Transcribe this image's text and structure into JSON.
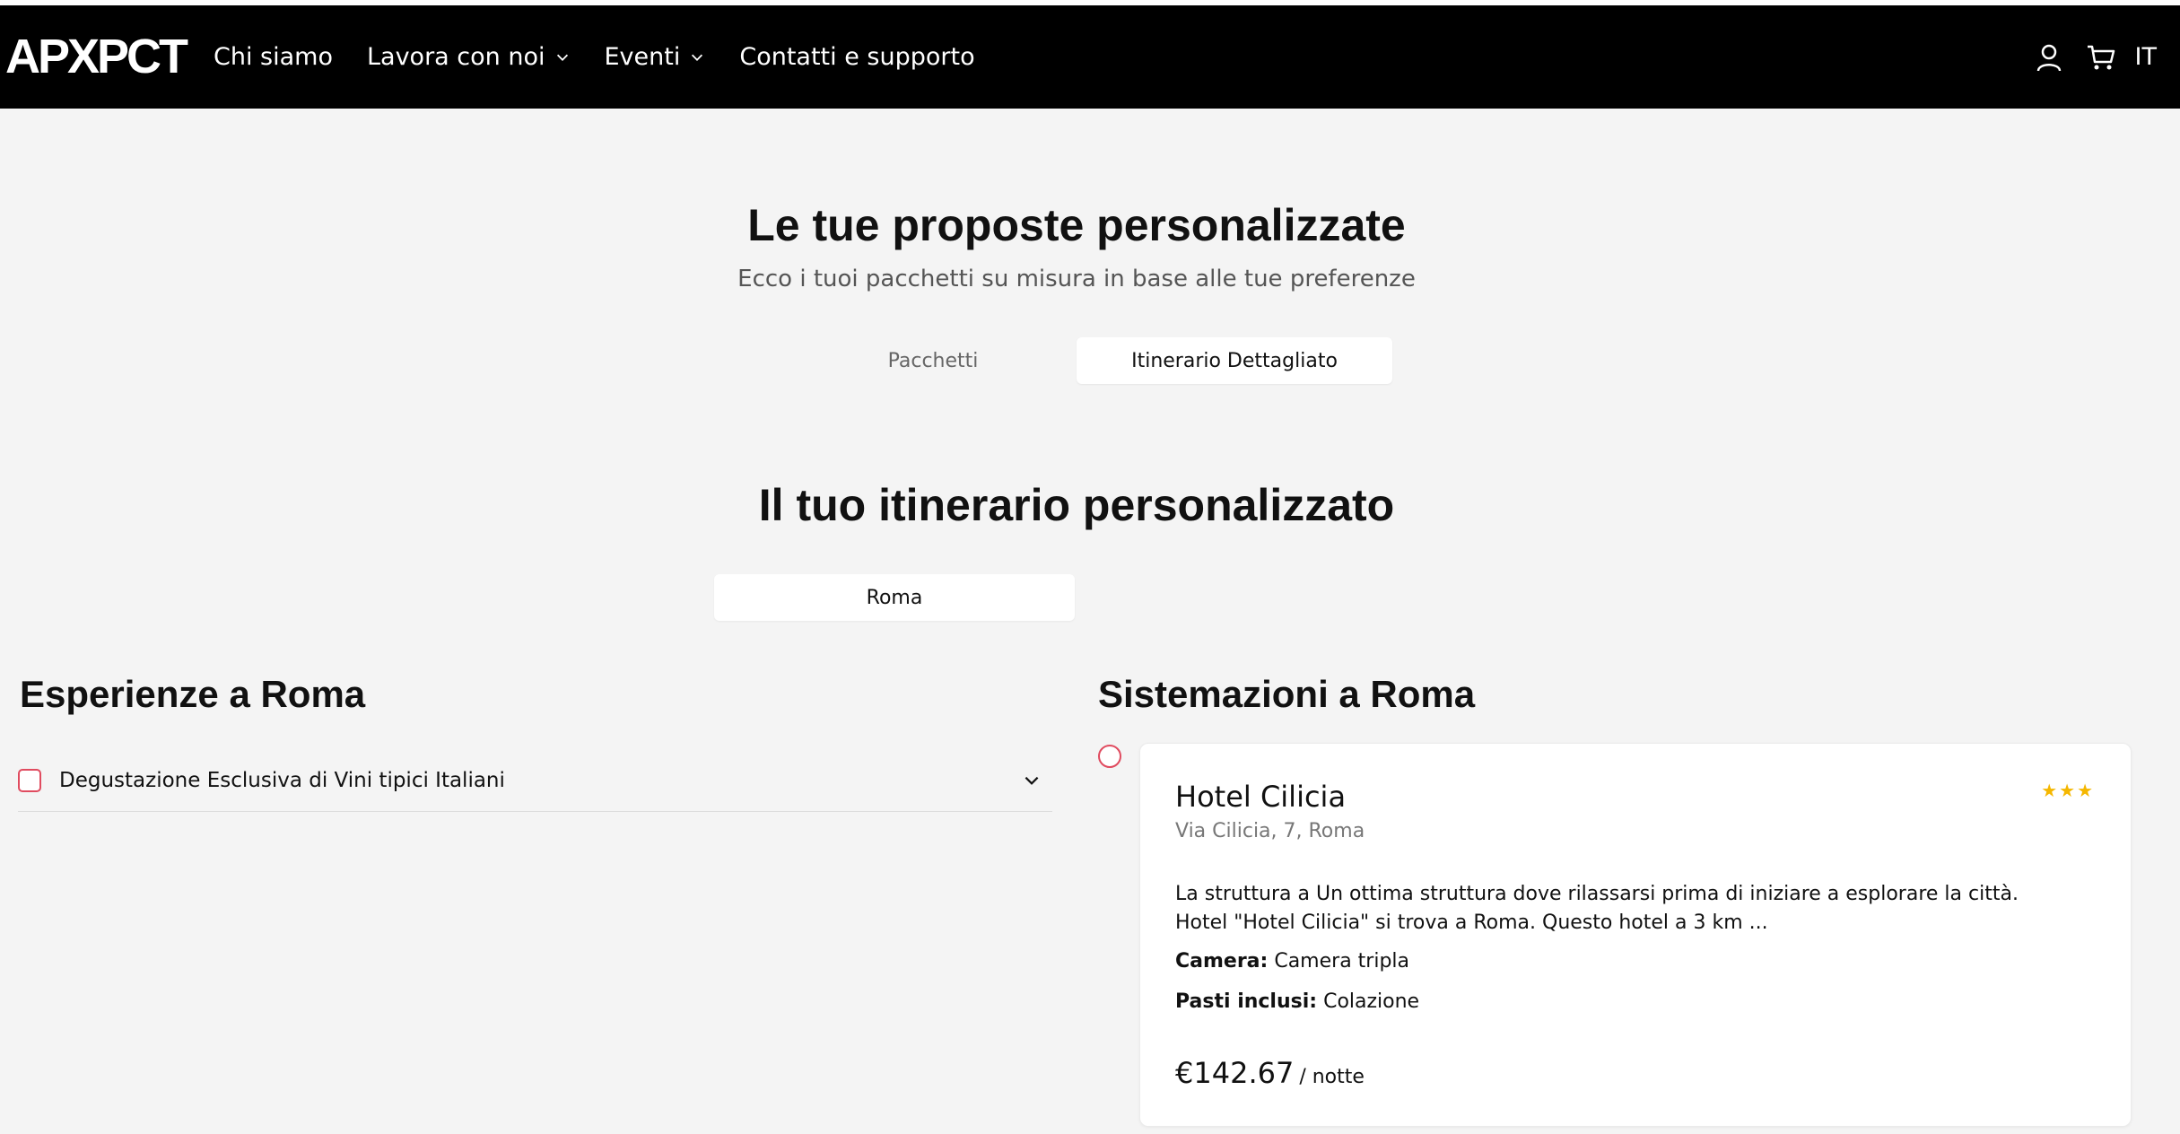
{
  "header": {
    "logo": "APXPCT",
    "nav": [
      "Chi siamo",
      "Lavora con noi",
      "Eventi",
      "Contatti e supporto"
    ],
    "icons": [
      "user-icon",
      "cart-icon"
    ],
    "language": "IT"
  },
  "main": {
    "title": "Le tue proposte personalizzate",
    "subtitle": "Ecco i tuoi pacchetti su misura in base alle tue preferenze",
    "tabs": [
      {
        "label": "Pacchetti",
        "active": false
      },
      {
        "label": "Itinerario Dettagliato",
        "active": true
      }
    ],
    "itinerary_title": "Il tuo itinerario personalizzato",
    "city": "Roma"
  },
  "experiences": {
    "title": "Esperienze a Roma",
    "items": [
      {
        "label": "Degustazione Esclusiva di Vini tipici Italiani",
        "checked": false
      }
    ]
  },
  "accommodations": {
    "title": "Sistemazioni a Roma",
    "hotel": {
      "name": "Hotel Cilicia",
      "stars": "★★★",
      "address": "Via Cilicia, 7, Roma",
      "description": "La struttura a Un ottima struttura dove rilassarsi prima di iniziare a esplorare la città. Hotel \"Hotel Cilicia\" si trova a Roma. Questo hotel a 3 km ...",
      "room_label": "Camera:",
      "room_value": "Camera tripla",
      "meals_label": "Pasti inclusi:",
      "meals_value": "Colazione",
      "price": "€142.67",
      "per": "/ notte"
    }
  },
  "colors": {
    "header_bg": "#000000",
    "page_bg": "#f4f4f4",
    "accent": "#e04b5f",
    "stars": "#f5b700"
  }
}
